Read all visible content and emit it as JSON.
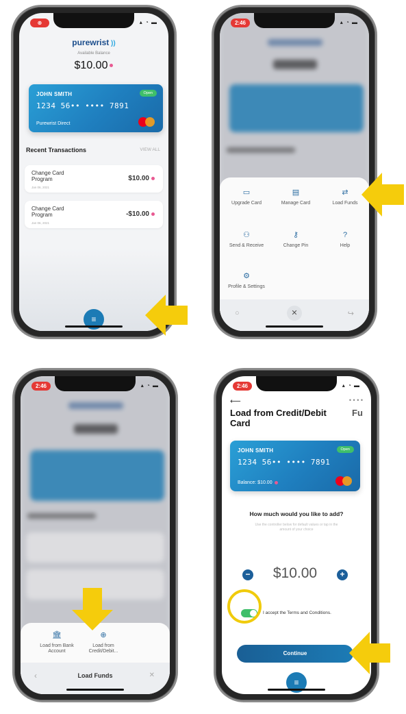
{
  "screen1": {
    "status_badge": "⊗",
    "brand": "purewrist",
    "balance_label": "Available Balance",
    "balance": "$10.00",
    "card": {
      "name": "JOHN SMITH",
      "number": "1234 56•• •••• 7891",
      "program": "Purewrist Direct",
      "badge": "Open"
    },
    "recent_title": "Recent Transactions",
    "view_all": "VIEW ALL",
    "transactions": [
      {
        "title": "Change Card Program",
        "date": "Jan 06, 2021",
        "amount": "$10.00"
      },
      {
        "title": "Change Card Program",
        "date": "Jan 06, 2021",
        "amount": "-$10.00"
      }
    ]
  },
  "screen2": {
    "time": "2:46",
    "menu": [
      {
        "label": "Upgrade Card",
        "icon": "card-upgrade-icon"
      },
      {
        "label": "Manage Card",
        "icon": "card-manage-icon"
      },
      {
        "label": "Load Funds",
        "icon": "load-funds-icon"
      },
      {
        "label": "Send & Receive",
        "icon": "people-icon"
      },
      {
        "label": "Change Pin",
        "icon": "pin-icon"
      },
      {
        "label": "Help",
        "icon": "help-icon"
      },
      {
        "label": "Profile & Settings",
        "icon": "gear-icon"
      }
    ]
  },
  "screen3": {
    "time": "2:46",
    "sheet_title": "Load Funds",
    "options": [
      {
        "label": "Load from Bank Account",
        "icon": "bank-icon"
      },
      {
        "label": "Load from Credit/Debit...",
        "icon": "card-load-icon"
      }
    ]
  },
  "screen4": {
    "time": "2:46",
    "title": "Load from Credit/Debit Card",
    "peek": "Fu",
    "card": {
      "name": "JOHN SMITH",
      "number": "1234 56•• •••• 7891",
      "balance": "Balance: $10.00",
      "badge": "Open"
    },
    "question": "How much would you like to add?",
    "hint": "Use the controller below for default values or tap in the amount of your choice",
    "amount": "$10.00",
    "terms": "I accept the Terms and Conditions.",
    "continue_label": "Continue"
  },
  "colors": {
    "accent": "#1c7bb5",
    "highlight": "#f5cc0c",
    "card": "#2a9fd6"
  }
}
